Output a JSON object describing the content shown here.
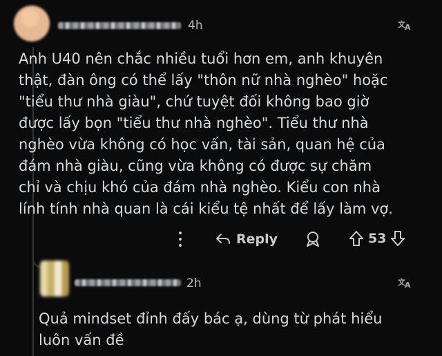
{
  "comment": {
    "timestamp": "4h",
    "body": "Anh U40 nên chắc nhiều tuổi hơn em, anh khuyên\nthật, đàn ông có thể lấy \"thôn nữ nhà nghèo\" hoặc\n\"tiểu thư nhà giàu\", chứ tuyệt đối không bao giờ\nđược lấy bọn \"tiểu thư nhà nghèo\". Tiểu thư nhà\nnghèo vừa không có học vấn, tài sản, quan hệ của\nđám nhà giàu, cũng vừa không có được sự chăm\nchỉ và chịu khó của đám nhà nghèo. Kiểu con nhà\nlính tính nhà quan là cái kiểu tệ nhất để lấy làm vợ.",
    "actions": {
      "reply_label": "Reply",
      "vote_count": "53"
    }
  },
  "reply": {
    "timestamp": "2h",
    "body": "Quả mindset đỉnh đấy bác ạ, dùng từ phát hiểu\nluôn vấn đề"
  },
  "icons": {
    "translate": "translate-icon",
    "more": "more-options-icon",
    "reply": "reply-arrow-icon",
    "award": "award-icon",
    "upvote": "upvote-icon",
    "downvote": "downvote-icon"
  },
  "colors": {
    "background": "#0b0b0c",
    "text": "#d7dadc",
    "muted": "#b9bcbf",
    "thread_line": "#343536"
  }
}
